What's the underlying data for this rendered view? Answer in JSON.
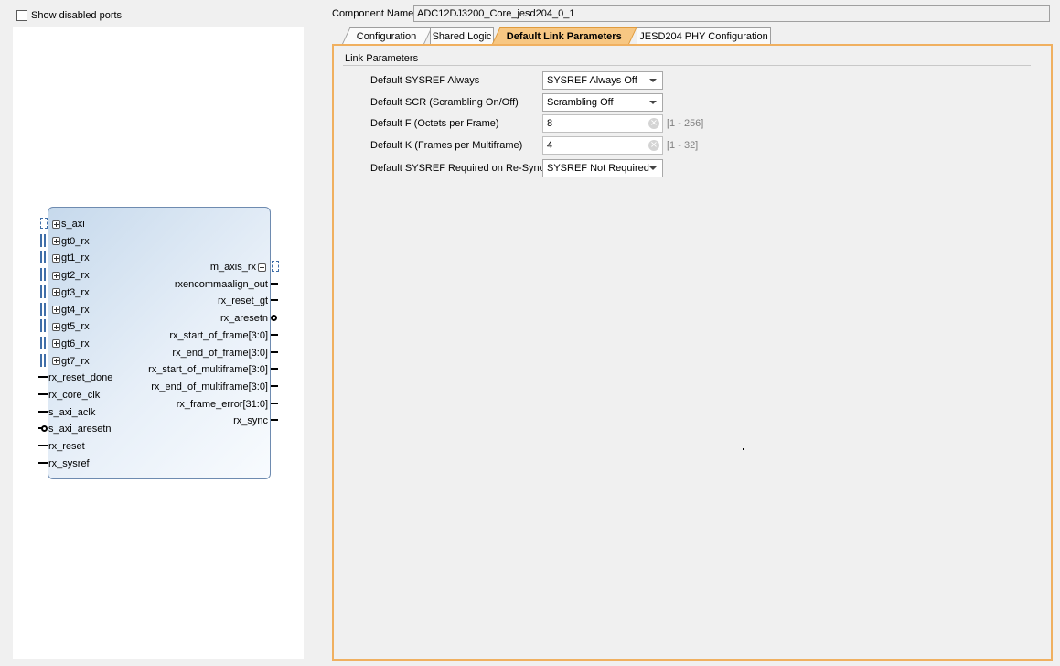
{
  "left_panel": {
    "show_disabled_ports_label": "Show disabled ports",
    "show_disabled_ports_checked": false
  },
  "block": {
    "left_ports": [
      {
        "name": "s_axi",
        "type": "axi"
      },
      {
        "name": "gt0_rx",
        "type": "bus"
      },
      {
        "name": "gt1_rx",
        "type": "bus"
      },
      {
        "name": "gt2_rx",
        "type": "bus"
      },
      {
        "name": "gt3_rx",
        "type": "bus"
      },
      {
        "name": "gt4_rx",
        "type": "bus"
      },
      {
        "name": "gt5_rx",
        "type": "bus"
      },
      {
        "name": "gt6_rx",
        "type": "bus"
      },
      {
        "name": "gt7_rx",
        "type": "bus"
      },
      {
        "name": "rx_reset_done",
        "type": "pin"
      },
      {
        "name": "rx_core_clk",
        "type": "pin"
      },
      {
        "name": "s_axi_aclk",
        "type": "pin"
      },
      {
        "name": "s_axi_aresetn",
        "type": "neg"
      },
      {
        "name": "rx_reset",
        "type": "pin"
      },
      {
        "name": "rx_sysref",
        "type": "pin"
      }
    ],
    "right_ports": [
      {
        "name": "m_axis_rx",
        "type": "axi"
      },
      {
        "name": "rxencommaalign_out",
        "type": "pin"
      },
      {
        "name": "rx_reset_gt",
        "type": "pin"
      },
      {
        "name": "rx_aresetn",
        "type": "neg"
      },
      {
        "name": "rx_start_of_frame[3:0]",
        "type": "pin"
      },
      {
        "name": "rx_end_of_frame[3:0]",
        "type": "pin"
      },
      {
        "name": "rx_start_of_multiframe[3:0]",
        "type": "pin"
      },
      {
        "name": "rx_end_of_multiframe[3:0]",
        "type": "pin"
      },
      {
        "name": "rx_frame_error[31:0]",
        "type": "pin"
      },
      {
        "name": "rx_sync",
        "type": "pin"
      }
    ]
  },
  "header": {
    "component_name_label": "Component Name",
    "component_name_value": "ADC12DJ3200_Core_jesd204_0_1"
  },
  "tabs": [
    {
      "label": "Configuration",
      "active": false
    },
    {
      "label": "Shared Logic",
      "active": false
    },
    {
      "label": "Default Link Parameters",
      "active": true
    },
    {
      "label": "JESD204 PHY Configuration",
      "active": false
    }
  ],
  "link_parameters": {
    "group_title": "Link Parameters",
    "sysref_always": {
      "label": "Default SYSREF Always",
      "value": "SYSREF Always Off"
    },
    "scr": {
      "label": "Default SCR (Scrambling On/Off)",
      "value": "Scrambling Off"
    },
    "f": {
      "label": "Default F (Octets per Frame)",
      "value": "8",
      "range": "[1 - 256]"
    },
    "k": {
      "label": "Default K (Frames per Multiframe)",
      "value": "4",
      "range": "[1 - 32]"
    },
    "sysref_resync": {
      "label": "Default SYSREF Required on Re-Sync",
      "value": "SYSREF Not Required"
    }
  },
  "colors": {
    "active_tab": "#f7c783",
    "content_border": "#f0b060",
    "block_fill": "#c6d9ec",
    "block_border": "#6e8bb0"
  }
}
